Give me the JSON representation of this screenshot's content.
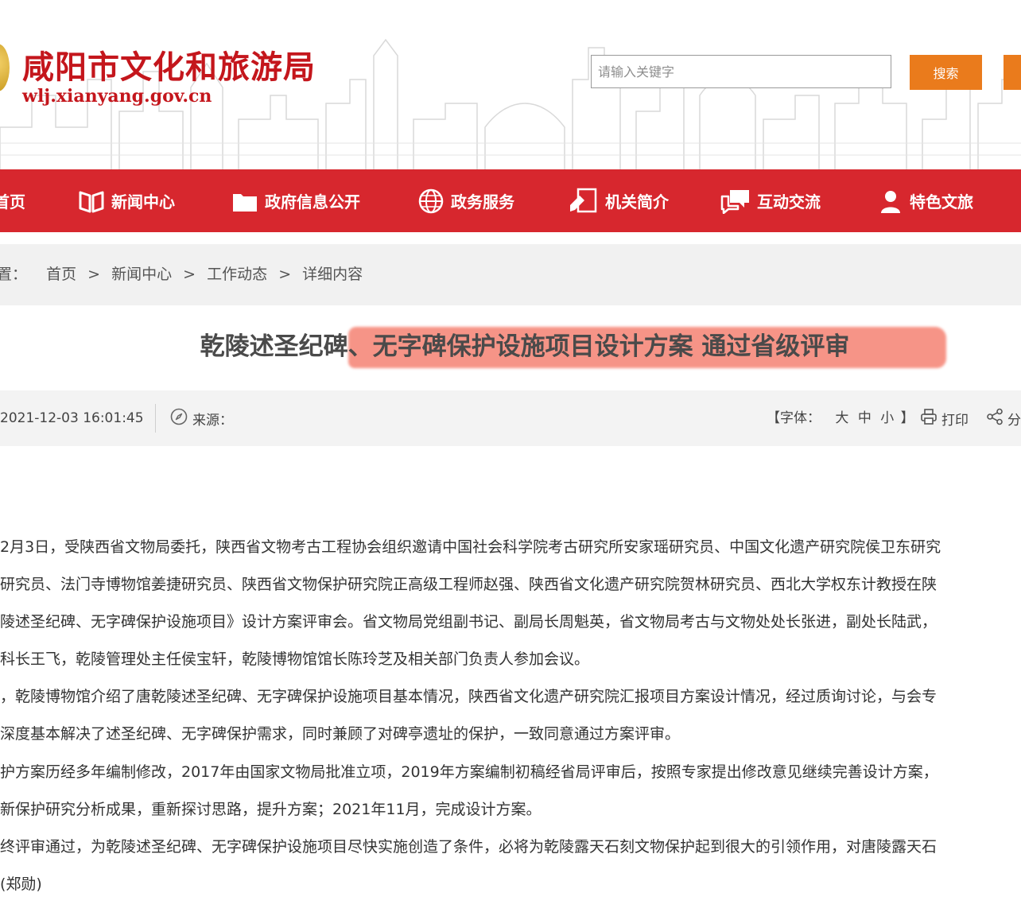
{
  "site": {
    "name": "咸阳市文化和旅游局",
    "url": "wlj.xianyang.gov.cn"
  },
  "search": {
    "placeholder": "请输入关键字",
    "button_label": "搜索"
  },
  "nav": {
    "items": [
      {
        "label": "首页",
        "icon": "home-icon"
      },
      {
        "label": "新闻中心",
        "icon": "book-icon"
      },
      {
        "label": "政府信息公开",
        "icon": "folder-icon"
      },
      {
        "label": "政务服务",
        "icon": "globe-icon"
      },
      {
        "label": "机关简介",
        "icon": "document-pen-icon"
      },
      {
        "label": "互动交流",
        "icon": "chat-icon"
      },
      {
        "label": "特色文旅",
        "icon": "person-icon"
      }
    ]
  },
  "breadcrumb": {
    "prefix": "置：",
    "items": [
      "首页",
      "新闻中心",
      "工作动态",
      "详细内容"
    ],
    "separator": ">"
  },
  "article": {
    "title": "乾陵述圣纪碑、无字碑保护设施项目设计方案 通过省级评审",
    "datetime": "2021-12-03 16:01:45",
    "source_label": "来源：",
    "font_label": "【字体：",
    "font_sizes": [
      "大",
      "中",
      "小"
    ],
    "font_close": "】",
    "print_label": "打印",
    "share_label": "分",
    "paragraphs": [
      "2月3日，受陕西省文物局委托，陕西省文物考古工程协会组织邀请中国社会科学院考古研究所安家瑶研究员、中国文化遗产研究院侯卫东研究",
      "研究员、法门寺博物馆姜捷研究员、陕西省文物保护研究院正高级工程师赵强、陕西省文化遗产研究院贺林研究员、西北大学权东计教授在陕",
      "陵述圣纪碑、无字碑保护设施项目》设计方案评审会。省文物局党组副书记、副局长周魁英，省文物局考古与文物处处长张进，副处长陆武，",
      "科长王飞，乾陵管理处主任侯宝轩，乾陵博物馆馆长陈玲芝及相关部门负责人参加会议。",
      "，乾陵博物馆介绍了唐乾陵述圣纪碑、无字碑保护设施项目基本情况，陕西省文化遗产研究院汇报项目方案设计情况，经过质询讨论，与会专",
      "深度基本解决了述圣纪碑、无字碑保护需求，同时兼顾了对碑亭遗址的保护，一致同意通过方案评审。",
      "护方案历经多年编制修改，2017年由国家文物局批准立项，2019年方案编制初稿经省局评审后，按照专家提出修改意见继续完善设计方案，",
      "新保护研究分析成果，重新探讨思路，提升方案；2021年11月，完成设计方案。",
      "终评审通过，为乾陵述圣纪碑、无字碑保护设施项目尽快实施创造了条件，必将为乾陵露天石刻文物保护起到很大的引领作用，对唐陵露天石",
      "(郑勋)"
    ]
  },
  "colors": {
    "brand_red": "#c4161c",
    "nav_red": "#d7272e",
    "search_orange": "#ea7b1c",
    "highlight": "#f4715f"
  }
}
